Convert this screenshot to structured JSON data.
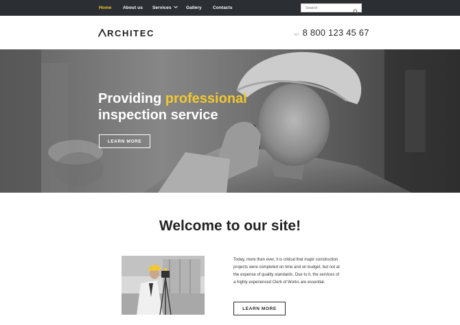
{
  "nav": {
    "items": [
      {
        "label": "Home",
        "active": true
      },
      {
        "label": "About us"
      },
      {
        "label": "Services",
        "has_dropdown": true
      },
      {
        "label": "Gallery"
      },
      {
        "label": "Contacts"
      }
    ],
    "search_placeholder": "Search"
  },
  "header": {
    "logo_text": "RCHITEC",
    "phone_label": "tel:",
    "phone_number": "8 800 123 45 67"
  },
  "hero": {
    "title_line1_plain": "Providing ",
    "title_line1_accent": "professional",
    "title_line2": "inspection service",
    "button_label": "LEARN MORE"
  },
  "welcome": {
    "heading": "Welcome to our site!",
    "paragraph": "Today, more than ever, it is critical that major construction projects were completed on time and on budget, but not at the expense of quality standards. Due to it, the services of a highly experienced Clerk of Works are essential.",
    "button_label": "LEARN MORE"
  },
  "colors": {
    "accent": "#f2c830",
    "topbar": "#2b2e32"
  },
  "icons": {
    "search": "search-icon",
    "dropdown": "chevron-down-icon",
    "logo": "logo-triangle-icon"
  }
}
